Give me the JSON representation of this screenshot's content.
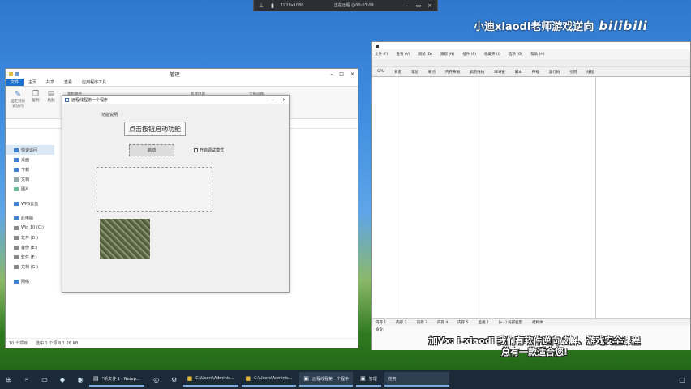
{
  "remote_banner": {
    "resolution": "1920x1080",
    "status": "正在远程 @00:03:09"
  },
  "watermark": {
    "text": "小迪xiaodi老师游戏逆向",
    "logo": "bilibili"
  },
  "explorer": {
    "title": "管理",
    "tabs": [
      "文件",
      "主页",
      "共享",
      "查看",
      "应用程序工具"
    ],
    "ribbon_labels": [
      "固定到快速访问",
      "复制",
      "粘贴",
      "复制路径",
      "新建项目",
      "全部选择"
    ],
    "nav": [
      "快速访问",
      "桌面",
      "下载",
      "文档",
      "图片",
      "WPS云盘",
      "此电脑",
      "Win 10 (C:)",
      "软件 (D:)",
      "备份 (E:)",
      "软件 (F:)",
      "文档 (G:)",
      "网络"
    ],
    "status_left": "10 个项目",
    "status_mid": "选中 1 个项目  1.26 KB"
  },
  "dialog": {
    "title": "远程线程第一个程序",
    "group_label": "功能说明",
    "main_button": "点击按钮启动功能",
    "secondary_button": "启动",
    "checkbox_label": "开启调试模式"
  },
  "debugger": {
    "menu": [
      "文件 (F)",
      "查看 (V)",
      "调试 (D)",
      "跟踪 (N)",
      "插件 (P)",
      "收藏夹 (I)",
      "选项 (O)",
      "帮助 (H)"
    ],
    "tabs": [
      "CPU",
      "日志",
      "笔记",
      "断点",
      "内存布局",
      "调用堆栈",
      "SEH链",
      "脚本",
      "符号",
      "源代码",
      "引用",
      "线程",
      "句柄",
      "跟踪"
    ],
    "bottom_tabs": [
      "内存 1",
      "内存 2",
      "内存 3",
      "内存 4",
      "内存 5",
      "监视 1",
      "[x=] 局部变量",
      "结构体"
    ],
    "bottom_label": "命令:"
  },
  "subtitle": {
    "line1": "加Vx: i-xiaodi 我们有软件逆向破解、游戏安全课程",
    "line2": "总有一款适合您!"
  },
  "taskbar": {
    "tasks": [
      "*新文件 1 - Notep...",
      "C:\\Users\\Adminis...",
      "C:\\Users\\Adminis...",
      "远程线程第一个程序",
      "管理",
      "任务"
    ]
  },
  "colors": {
    "accent": "#1e6fc9",
    "taskbar": "#1c2a38",
    "desktop_top": "#2f78cf",
    "desktop_bottom": "#1d5e15"
  }
}
